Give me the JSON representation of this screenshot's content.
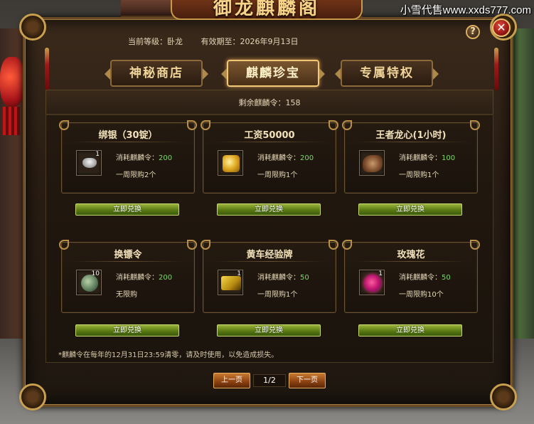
{
  "header": {
    "title": "御龙麒麟阁",
    "watermark": "小雪代售www.xxds777.com",
    "help": "?",
    "close": "✕"
  },
  "info": {
    "level": "当前等级：卧龙",
    "expiry": "有效期至：2026年9月13日"
  },
  "tabs": [
    {
      "label": "神秘商店",
      "active": false
    },
    {
      "label": "麒麟珍宝",
      "active": true
    },
    {
      "label": "专属特权",
      "active": false
    }
  ],
  "remaining": "剩余麒麟令：158",
  "items": [
    {
      "title": "绑银（30锭）",
      "cost_label": "消耗麒麟令：",
      "cost": "200",
      "limit": "一周限购2个",
      "qty": "1",
      "icon": "silver-ingot-icon"
    },
    {
      "title": "工资50000",
      "cost_label": "消耗麒麟令：",
      "cost": "200",
      "limit": "一周限购1个",
      "qty": "",
      "icon": "gold-coins-icon"
    },
    {
      "title": "王者龙心(1小时)",
      "cost_label": "消耗麒麟令：",
      "cost": "100",
      "limit": "一周限购1个",
      "qty": "",
      "icon": "dragon-heart-icon"
    },
    {
      "title": "换镖令",
      "cost_label": "消耗麒麟令：",
      "cost": "200",
      "limit": "无限购",
      "qty": "10",
      "icon": "escort-token-icon"
    },
    {
      "title": "黄车经验牌",
      "cost_label": "消耗麒麟令：",
      "cost": "50",
      "limit": "一周限购1个",
      "qty": "1",
      "icon": "yellow-cart-icon"
    },
    {
      "title": "玫瑰花",
      "cost_label": "消耗麒麟令：",
      "cost": "50",
      "limit": "一周限购10个",
      "qty": "1",
      "icon": "rose-icon"
    }
  ],
  "exchange_label": "立即兑换",
  "note": "*麒麟令在每年的12月31日23:59清零，请及时使用，以免造成损失。",
  "pager": {
    "prev": "上一页",
    "page": "1/2",
    "next": "下一页"
  },
  "colors": {
    "accent_gold": "#f0c878",
    "cost_green": "#7ed86a",
    "button_green": "#5a7a14"
  }
}
